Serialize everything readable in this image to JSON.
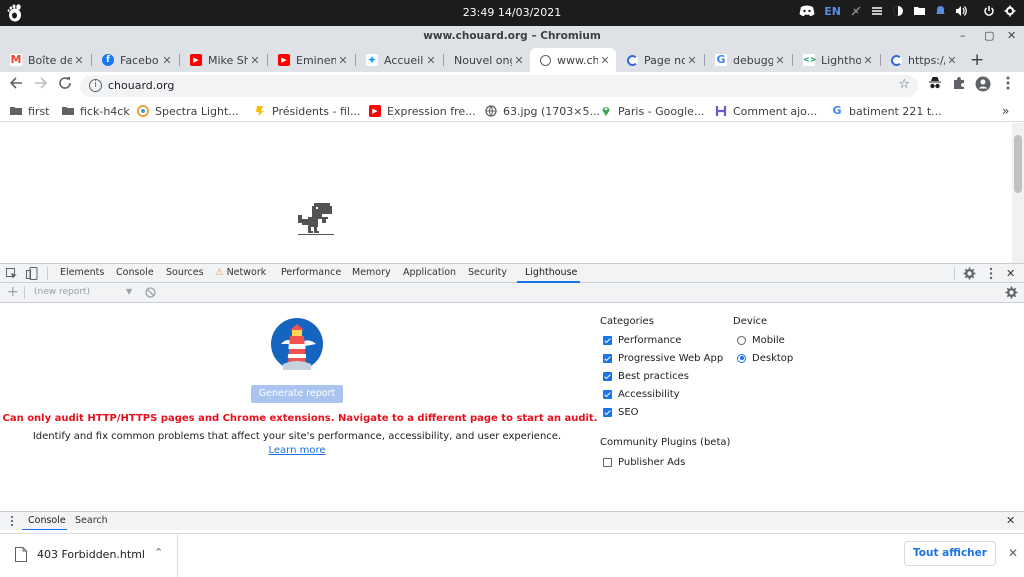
{
  "topbar": {
    "clock": "23:49 14/03/2021",
    "lang": "EN"
  },
  "window": {
    "title": "www.chouard.org – Chromium",
    "minimize": "–",
    "maximize": "▢",
    "close": "✕"
  },
  "tabs": [
    {
      "label": "Boîte de",
      "favicon_text": "M",
      "favicon_color": "#ea4335"
    },
    {
      "label": "Facebo",
      "favicon_text": "f",
      "favicon_color": "#1877f2"
    },
    {
      "label": "Mike Sh",
      "favicon_text": "▶",
      "favicon_color": "#ff0000"
    },
    {
      "label": "Eminen",
      "favicon_text": "▶",
      "favicon_color": "#ff0000"
    },
    {
      "label": "Accueil",
      "favicon_text": "t",
      "favicon_color": "#1da1f2"
    },
    {
      "label": "Nouvel ong",
      "favicon_text": "",
      "favicon_color": ""
    },
    {
      "label": "www.ch",
      "favicon_text": "",
      "favicon_color": "#5f6368",
      "active": true
    },
    {
      "label": "Page no",
      "favicon_text": "",
      "favicon_color": "#3367d6"
    },
    {
      "label": "debugg",
      "favicon_text": "G",
      "favicon_color": "#4285f4"
    },
    {
      "label": "Lightho",
      "favicon_text": "",
      "favicon_color": "#0f9d58"
    },
    {
      "label": "https://",
      "favicon_text": "",
      "favicon_color": "#3367d6"
    }
  ],
  "new_tab_label": "+",
  "toolbar": {
    "url": "chouard.org"
  },
  "bookmarks": [
    {
      "label": "first",
      "icon_color": "#5f6368",
      "icon_text": ""
    },
    {
      "label": "fick-h4ck",
      "icon_color": "#5f6368",
      "icon_text": ""
    },
    {
      "label": "Spectra Light...",
      "icon_color": "#e8a33d",
      "icon_text": ""
    },
    {
      "label": "Présidents - fil...",
      "icon_color": "#fbbc04",
      "icon_text": ""
    },
    {
      "label": "Expression fre...",
      "icon_color": "#ff0000",
      "icon_text": "▶"
    },
    {
      "label": "63.jpg (1703×5...",
      "icon_color": "#5f6368",
      "icon_text": ""
    },
    {
      "label": "Paris - Google...",
      "icon_color": "#34a853",
      "icon_text": ""
    },
    {
      "label": "Comment ajo...",
      "icon_color": "#6a5acd",
      "icon_text": ""
    },
    {
      "label": "batiment 221 t...",
      "icon_color": "#4285f4",
      "icon_text": "G"
    }
  ],
  "bookmarks_more": "»",
  "devtools": {
    "tabs": [
      "Elements",
      "Console",
      "Sources",
      "Network",
      "Performance",
      "Memory",
      "Application",
      "Security",
      "Lighthouse"
    ],
    "active_tab": "Lighthouse",
    "report_placeholder": "(new report)",
    "add": "+",
    "close": "✕"
  },
  "lighthouse": {
    "generate_button": "Generate report",
    "error": "Can only audit HTTP/HTTPS pages and Chrome extensions. Navigate to a different page to start an audit.",
    "description": "Identify and fix common problems that affect your site's performance, accessibility, and user experience.",
    "learn_more": "Learn more",
    "categories_title": "Categories",
    "categories": [
      {
        "label": "Performance",
        "checked": true
      },
      {
        "label": "Progressive Web App",
        "checked": true
      },
      {
        "label": "Best practices",
        "checked": true
      },
      {
        "label": "Accessibility",
        "checked": true
      },
      {
        "label": "SEO",
        "checked": true
      }
    ],
    "device_title": "Device",
    "devices": [
      {
        "label": "Mobile",
        "selected": false
      },
      {
        "label": "Desktop",
        "selected": true
      }
    ],
    "plugins_title": "Community Plugins (beta)",
    "plugins": [
      {
        "label": "Publisher Ads",
        "checked": false
      }
    ]
  },
  "drawer": {
    "tabs": [
      "Console",
      "Search"
    ],
    "active_tab": "Console"
  },
  "downloads": {
    "file": "403 Forbidden.html",
    "show_all": "Tout afficher"
  },
  "colors": {
    "accent": "#1a73e8",
    "error": "#e8101d",
    "chrome_frame": "#dee1e6",
    "topbar": "#1c1c1c"
  }
}
